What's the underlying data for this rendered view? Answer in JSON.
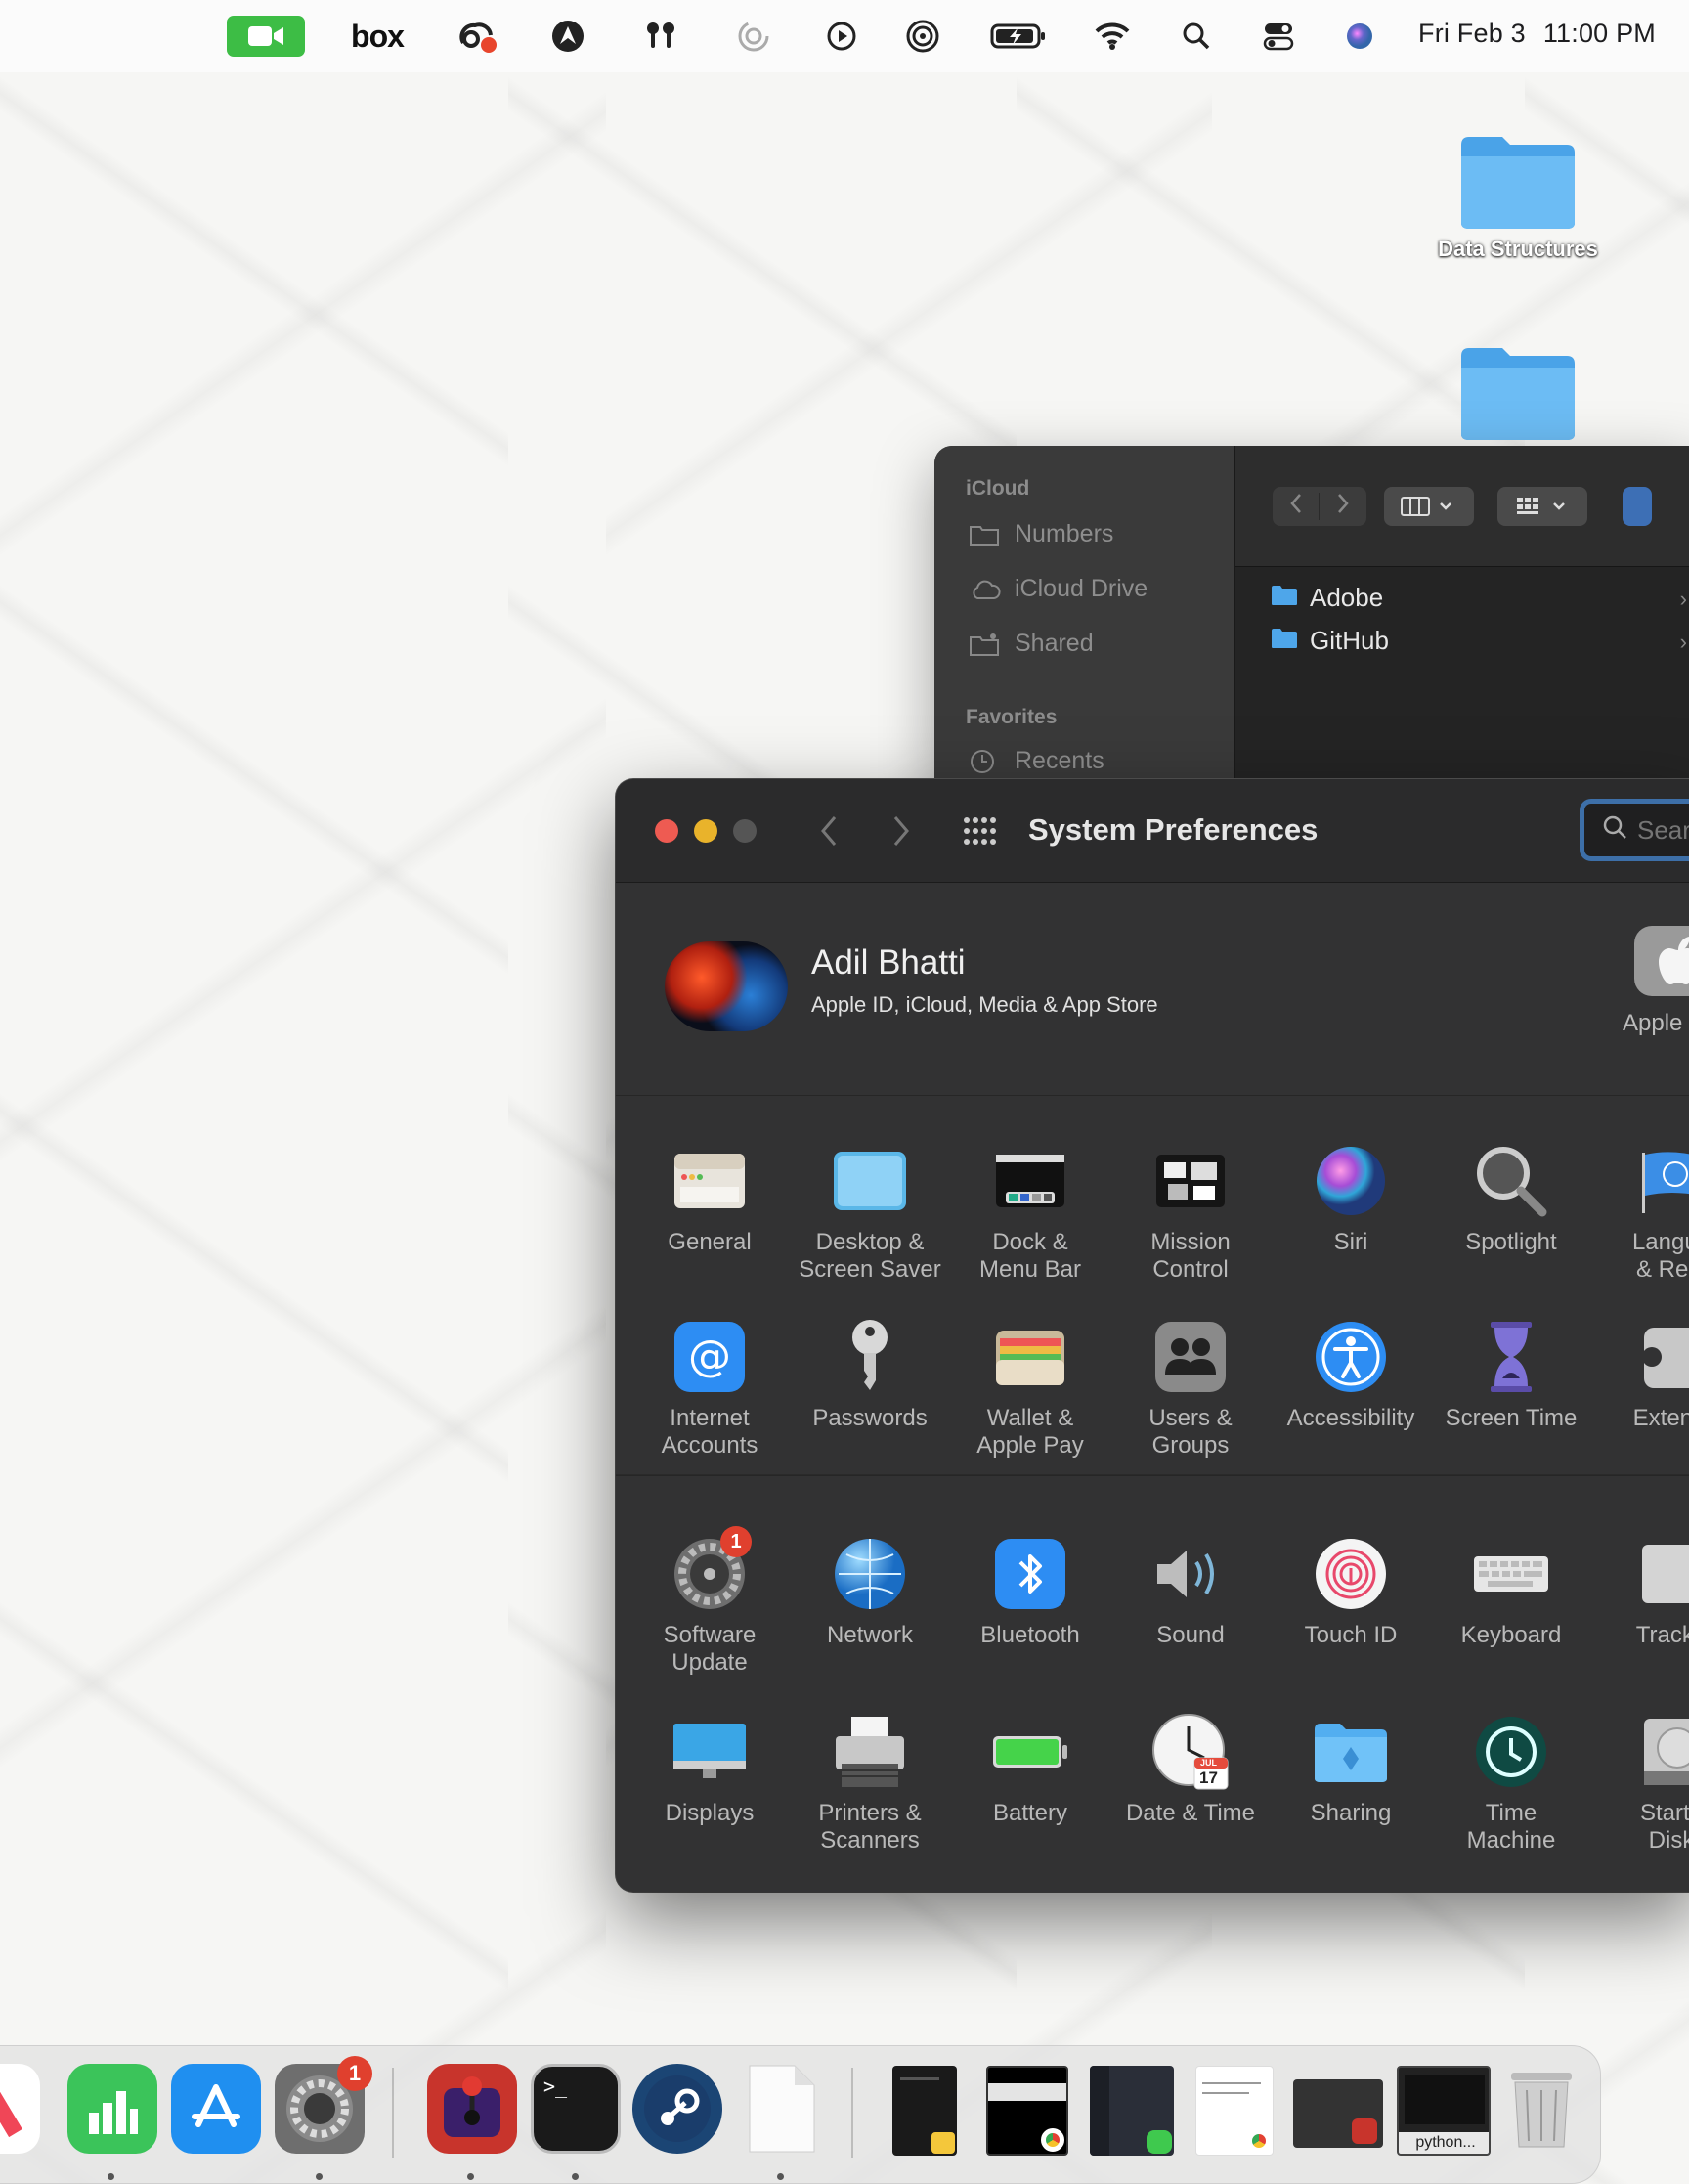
{
  "menubar": {
    "date": "Fri Feb 3",
    "time": "11:00 PM",
    "box_label": "box",
    "icons": [
      "facetime-icon",
      "box-icon",
      "creative-cloud-icon",
      "avast-icon",
      "airpods-icon",
      "focus-icon",
      "play-icon",
      "airdrop-icon",
      "battery-icon",
      "wifi-icon",
      "search-icon",
      "control-center-icon",
      "siri-icon"
    ]
  },
  "desktop": {
    "folders": [
      {
        "label": "Data Structures"
      },
      {
        "label": ""
      }
    ]
  },
  "finder": {
    "sidebar": {
      "icloud_heading": "iCloud",
      "icloud_items": [
        "Numbers",
        "iCloud Drive",
        "Shared"
      ],
      "favorites_heading": "Favorites",
      "favorites_items": [
        "Recents"
      ]
    },
    "files": [
      "Adobe",
      "GitHub"
    ]
  },
  "sysprefs": {
    "title": "System Preferences",
    "search_placeholder": "Search",
    "account": {
      "name": "Adil Bhatti",
      "subtitle": "Apple ID, iCloud, Media & App Store",
      "apple_label": "Apple"
    },
    "rows": [
      [
        "General",
        "Desktop &\nScreen Saver",
        "Dock &\nMenu Bar",
        "Mission\nControl",
        "Siri",
        "Spotlight",
        "Langua\n& Regi"
      ],
      [
        "Internet\nAccounts",
        "Passwords",
        "Wallet &\nApple Pay",
        "Users &\nGroups",
        "Accessibility",
        "Screen Time",
        "Extensi"
      ],
      [
        "Software\nUpdate",
        "Network",
        "Bluetooth",
        "Sound",
        "Touch ID",
        "Keyboard",
        "Trackp"
      ],
      [
        "Displays",
        "Printers &\nScanners",
        "Battery",
        "Date & Time",
        "Sharing",
        "Time\nMachine",
        "Startu\nDisk"
      ]
    ],
    "software_update_badge": "1",
    "calendar_month": "JUL",
    "calendar_day": "17"
  },
  "dock": {
    "system_prefs_badge": "1",
    "terminal_prompt": ">_",
    "python_label": "python..."
  }
}
